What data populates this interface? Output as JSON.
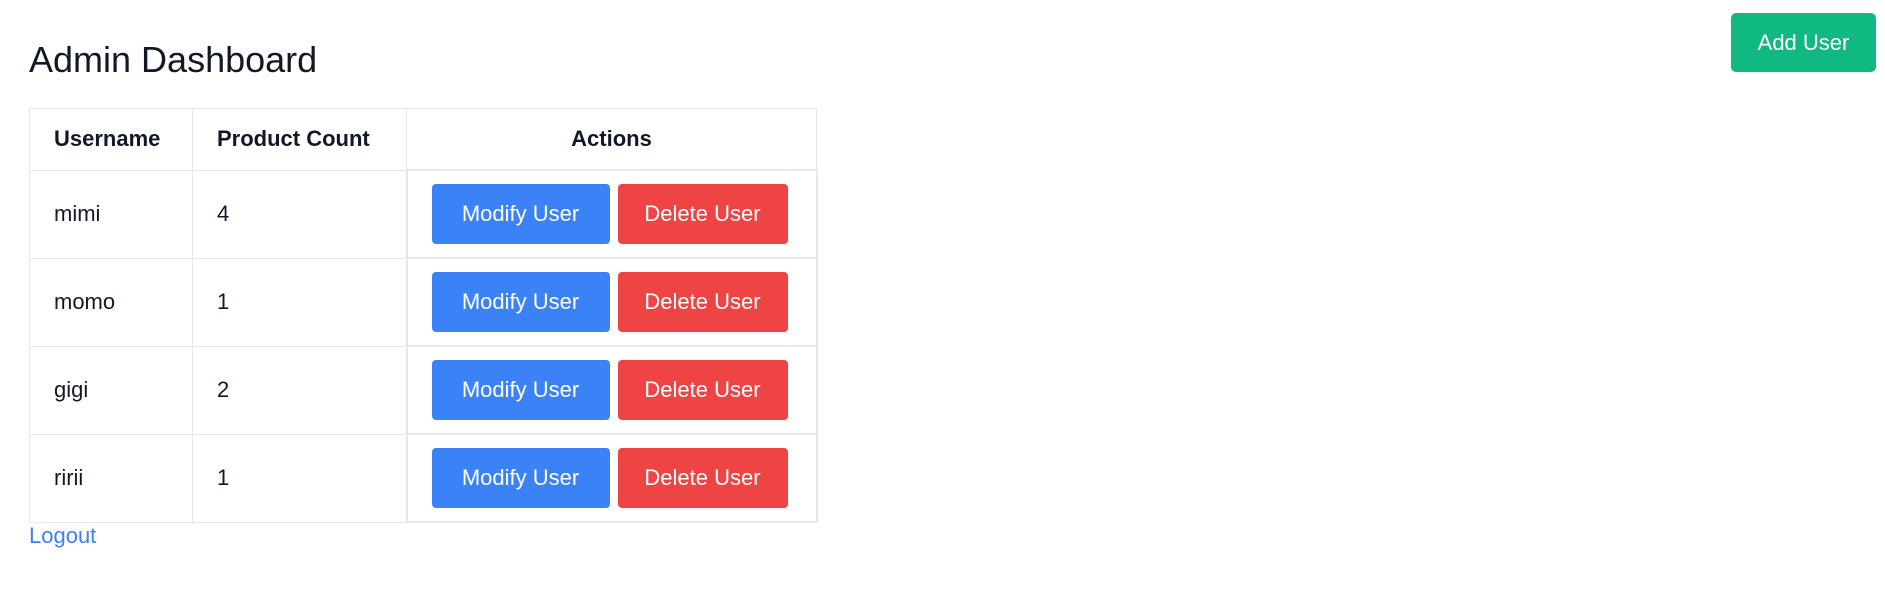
{
  "header": {
    "title": "Admin Dashboard",
    "add_user_label": "Add User"
  },
  "table": {
    "columns": [
      "Username",
      "Product Count",
      "Actions"
    ],
    "rows": [
      {
        "username": "mimi",
        "product_count": "4",
        "modify_label": "Modify User",
        "delete_label": "Delete User"
      },
      {
        "username": "momo",
        "product_count": "1",
        "modify_label": "Modify User",
        "delete_label": "Delete User"
      },
      {
        "username": "gigi",
        "product_count": "2",
        "modify_label": "Modify User",
        "delete_label": "Delete User"
      },
      {
        "username": "ririi",
        "product_count": "1",
        "modify_label": "Modify User",
        "delete_label": "Delete User"
      }
    ]
  },
  "footer": {
    "logout_label": "Logout"
  },
  "colors": {
    "add_user": "#10b981",
    "modify": "#3b82f6",
    "delete": "#ef4444",
    "link": "#3b82f6"
  }
}
